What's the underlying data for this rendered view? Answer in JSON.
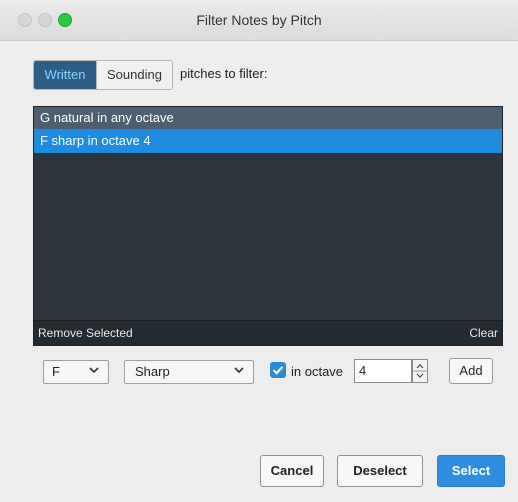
{
  "window": {
    "title": "Filter Notes by Pitch"
  },
  "mode": {
    "options": [
      "Written",
      "Sounding"
    ],
    "selected": "Written",
    "label": "pitches to filter:"
  },
  "list": {
    "items": [
      "G natural in any octave",
      "F sharp in octave 4"
    ],
    "selected_index": 1,
    "footer": {
      "remove_label": "Remove Selected",
      "clear_label": "Clear"
    }
  },
  "controls": {
    "note": "F",
    "accidental": "Sharp",
    "in_octave_checked": true,
    "in_octave_label": "in octave",
    "octave_value": "4",
    "add_label": "Add"
  },
  "buttons": {
    "cancel": "Cancel",
    "deselect": "Deselect",
    "select": "Select"
  },
  "colors": {
    "accent": "#2e8de0",
    "list_background": "#2d343b",
    "selected_row": "#1e8bde"
  }
}
